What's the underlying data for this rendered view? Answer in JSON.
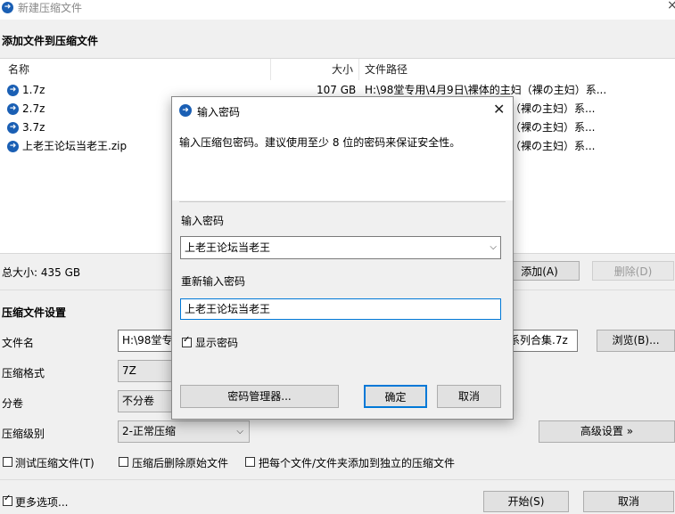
{
  "window": {
    "title": "新建压缩文件",
    "close_glyph": "×"
  },
  "add_section": {
    "title": "添加文件到压缩文件"
  },
  "file_list": {
    "columns": [
      "名称",
      "大小",
      "文件路径"
    ],
    "rows": [
      {
        "name": "1.7z",
        "size": "107 GB",
        "path": "H:\\98堂专用\\4月9日\\裸体的主妇（裸の主妇）系..."
      },
      {
        "name": "2.7z",
        "size": "",
        "path": "妇（裸の主妇）系..."
      },
      {
        "name": "3.7z",
        "size": "",
        "path": "妇（裸の主妇）系..."
      },
      {
        "name": "上老王论坛当老王.zip",
        "size": "",
        "path": "妇（裸の主妇）系..."
      }
    ]
  },
  "total_size": "总大小: 435 GB",
  "buttons": {
    "add": "添加(A)",
    "delete": "删除(D)",
    "browse": "浏览(B)...",
    "advanced": "高级设置 »",
    "start": "开始(S)",
    "cancel": "取消"
  },
  "settings": {
    "title": "压缩文件设置",
    "filename_label": "文件名",
    "filename_value": "H:\\98堂专",
    "filename_suffix": "系列合集.7z",
    "format_label": "压缩格式",
    "format_value": "7Z",
    "split_label": "分卷",
    "split_value": "不分卷",
    "level_label": "压缩级别",
    "level_value": "2-正常压缩"
  },
  "options": {
    "test": "测试压缩文件(T)",
    "delete_after": "压缩后删除原始文件",
    "separate": "把每个文件/文件夹添加到独立的压缩文件",
    "more": "更多选项..."
  },
  "dialog": {
    "title": "输入密码",
    "description": "输入压缩包密码。建议使用至少 8 位的密码来保证安全性。",
    "password_label": "输入密码",
    "password_value": "上老王论坛当老王",
    "reenter_label": "重新输入密码",
    "reenter_value": "上老王论坛当老王",
    "show_password": "显示密码",
    "manager_button": "密码管理器...",
    "ok_button": "确定",
    "cancel_button": "取消"
  }
}
